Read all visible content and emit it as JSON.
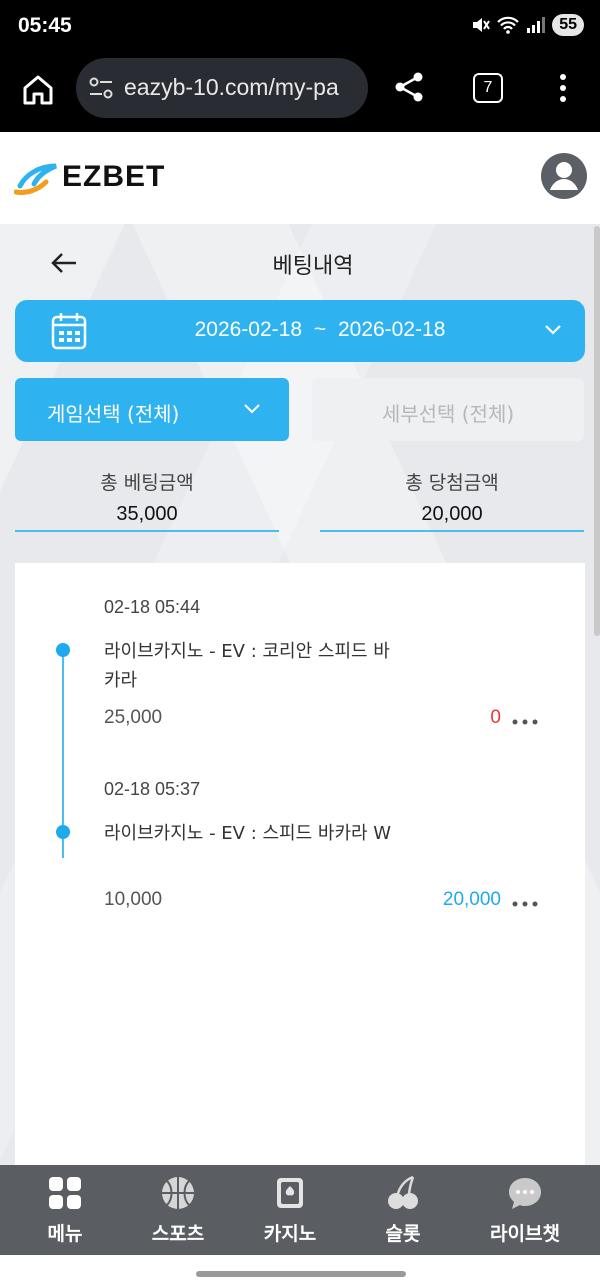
{
  "status_bar": {
    "time": "05:45",
    "battery": "55"
  },
  "browser": {
    "url": "eazyb-10.com/my-pa",
    "tab_count": "7"
  },
  "site": {
    "brand": "EZBET"
  },
  "page": {
    "title": "베팅내역"
  },
  "date_range": {
    "start": "2026-02-18",
    "separator": "~",
    "end": "2026-02-18"
  },
  "filters": {
    "game_select": "게임선택 (전체)",
    "detail_select": "세부선택 (전체)"
  },
  "totals": {
    "bet_label": "총 베팅금액",
    "bet_value": "35,000",
    "win_label": "총 당첨금액",
    "win_value": "20,000"
  },
  "bets": [
    {
      "time": "02-18 05:44",
      "game": "라이브카지노 - EV : 코리안 스피드 바카라",
      "stake": "25,000",
      "result": "0",
      "result_color": "#e53935"
    },
    {
      "time": "02-18 05:37",
      "game": "라이브카지노 - EV : 스피드 바카라 W",
      "stake": "10,000",
      "result": "20,000",
      "result_color": "#1faaf0"
    }
  ],
  "bottom_nav": [
    {
      "label": "메뉴",
      "icon": "grid-icon"
    },
    {
      "label": "스포츠",
      "icon": "basketball-icon"
    },
    {
      "label": "카지노",
      "icon": "cards-icon"
    },
    {
      "label": "슬롯",
      "icon": "cherry-icon"
    },
    {
      "label": "라이브챗",
      "icon": "chat-icon"
    }
  ],
  "colors": {
    "accent": "#2fb3f0",
    "loss": "#e53935",
    "win": "#1faaf0",
    "nav_bg": "#5a5d61"
  }
}
